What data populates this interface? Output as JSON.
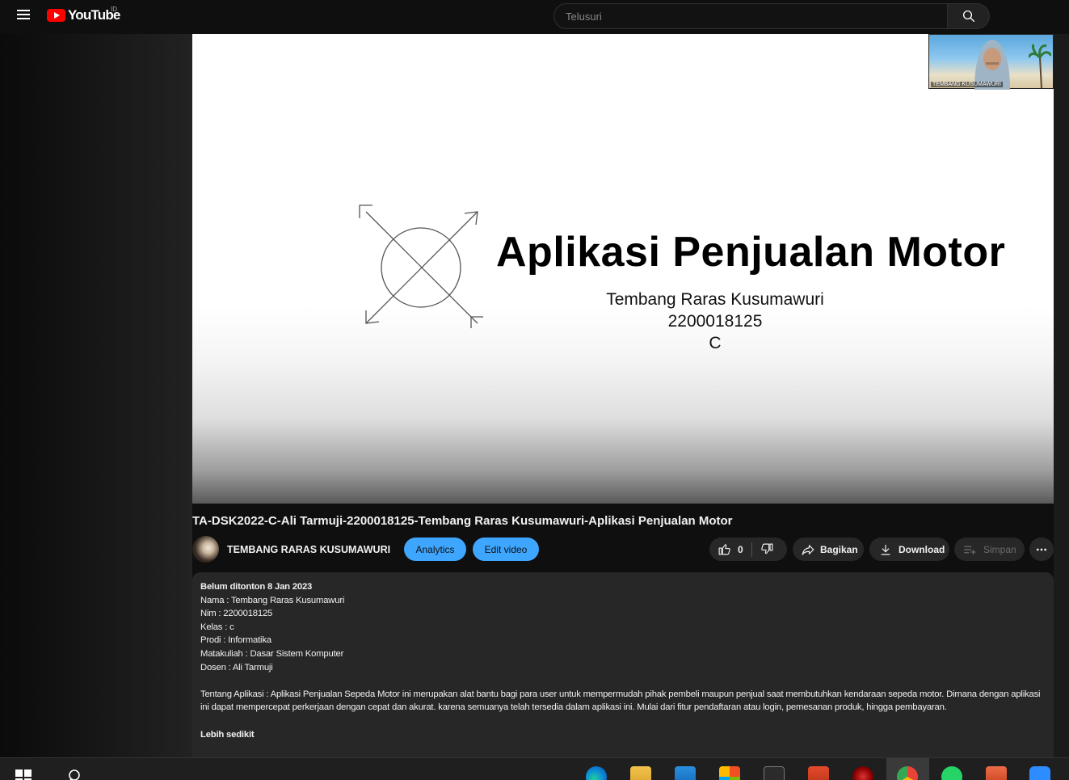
{
  "header": {
    "logo_text": "YouTube",
    "region": "ID",
    "search_placeholder": "Telusuri"
  },
  "player": {
    "slide_title": "Aplikasi Penjualan Motor",
    "slide_name": "Tembang Raras Kusumawuri",
    "slide_nim": "2200018125",
    "slide_class": "C",
    "webcam_label": "TEMBANG KUSUMAWURI"
  },
  "video": {
    "title": "TA-DSK2022-C-Ali Tarmuji-2200018125-Tembang Raras Kusumawuri-Aplikasi Penjualan Motor",
    "channel_name": "TEMBANG RARAS KUSUMAWURI",
    "analytics_label": "Analytics",
    "edit_label": "Edit video",
    "like_count": "0",
    "share_label": "Bagikan",
    "download_label": "Download",
    "save_label": "Simpan"
  },
  "description": {
    "meta": "Belum ditonton  8 Jan 2023",
    "lines": [
      "Nama : Tembang Raras Kusumawuri",
      "Nim : 2200018125",
      "Kelas : c",
      "Prodi : Informatika",
      "Matakuliah : Dasar Sistem Komputer",
      "Dosen : Ali Tarmuji"
    ],
    "about": "Tentang Aplikasi : Aplikasi Penjualan Sepeda Motor ini merupakan alat bantu bagi para user untuk  mempermudah pihak pembeli maupun penjual  saat membutuhkan kendaraan sepeda motor. Dimana dengan aplikasi ini  dapat mempercepat perkerjaan dengan cepat dan akurat. karena semuanya telah tersedia dalam aplikasi ini. Mulai dari fitur pendaftaran atau login, pemesanan produk, hingga pembayaran.",
    "show_less": "Lebih sedikit"
  },
  "colors": {
    "background": "#0f0f0f",
    "accent_blue": "#3ea6ff",
    "youtube_red": "#ff0000",
    "pill": "#272727"
  },
  "taskbar": {
    "icons": [
      "windows-start-icon",
      "search-icon",
      "edge-icon",
      "file-explorer-icon",
      "mail-icon",
      "store-icon",
      "terminal-icon",
      "office-icon",
      "app-red-icon",
      "chrome-icon",
      "whatsapp-icon",
      "powerpoint-icon",
      "zoom-icon"
    ]
  }
}
